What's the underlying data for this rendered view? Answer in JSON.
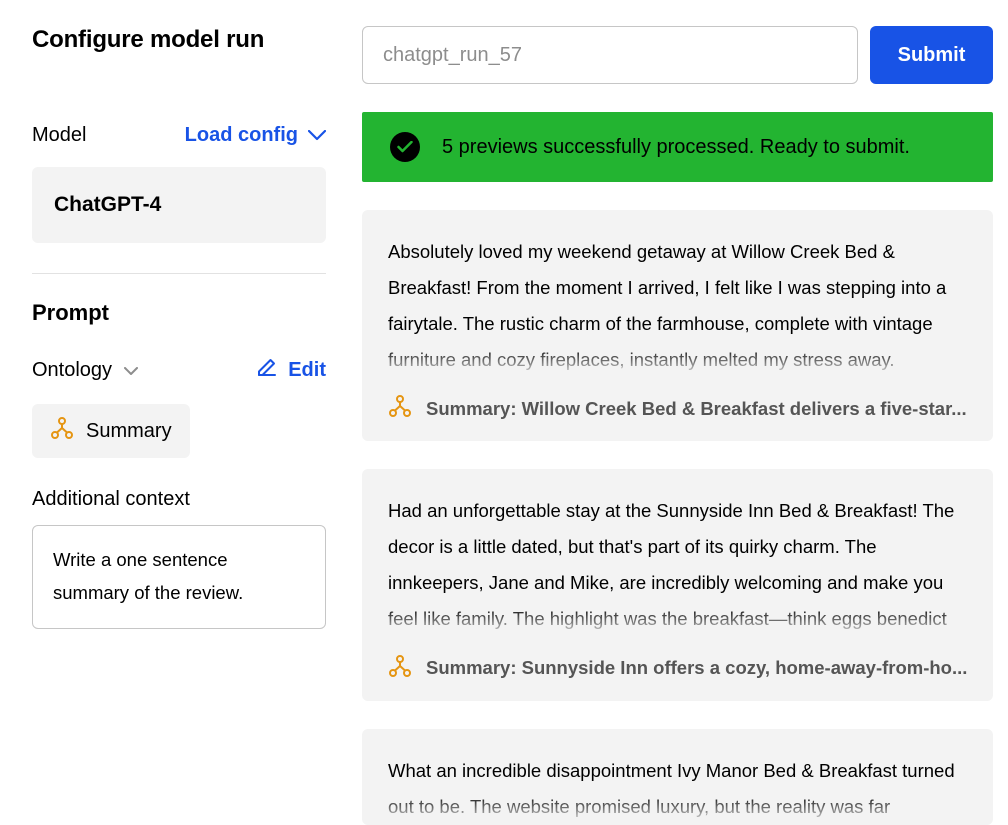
{
  "header": {
    "title": "Configure model run",
    "run_name_placeholder": "chatgpt_run_57",
    "submit_label": "Submit"
  },
  "model_section": {
    "label": "Model",
    "load_config_label": "Load config",
    "selected_model": "ChatGPT-4"
  },
  "prompt_section": {
    "title": "Prompt",
    "ontology_label": "Ontology",
    "edit_label": "Edit",
    "ontology_item": "Summary",
    "context_label": "Additional context",
    "context_value": "Write a one sentence summary of the review."
  },
  "status": {
    "message": "5 previews successfully processed. Ready to submit."
  },
  "previews": [
    {
      "text": "Absolutely loved my weekend getaway at Willow Creek Bed & Breakfast! From the moment I arrived, I felt like I was stepping into a fairytale. The rustic charm of the farmhouse, complete with vintage furniture and cozy fireplaces, instantly melted my stress away.",
      "summary": "Summary: Willow Creek Bed & Breakfast delivers a five-star..."
    },
    {
      "text": "Had an unforgettable stay at the Sunnyside Inn Bed & Breakfast! The decor is a little dated, but that's part of its quirky charm. The innkeepers, Jane and Mike, are incredibly welcoming and make you feel like family. The highlight was the breakfast—think eggs benedict",
      "summary": "Summary: Sunnyside Inn offers a cozy, home-away-from-ho..."
    },
    {
      "text": "What an incredible disappointment Ivy Manor Bed & Breakfast turned out to be. The website promised luxury, but the reality was far",
      "summary": ""
    }
  ],
  "icons": {
    "ontology": "ontology-tree-icon",
    "check": "check-circle-icon",
    "chevron": "chevron-down-icon",
    "pencil": "pencil-icon"
  }
}
